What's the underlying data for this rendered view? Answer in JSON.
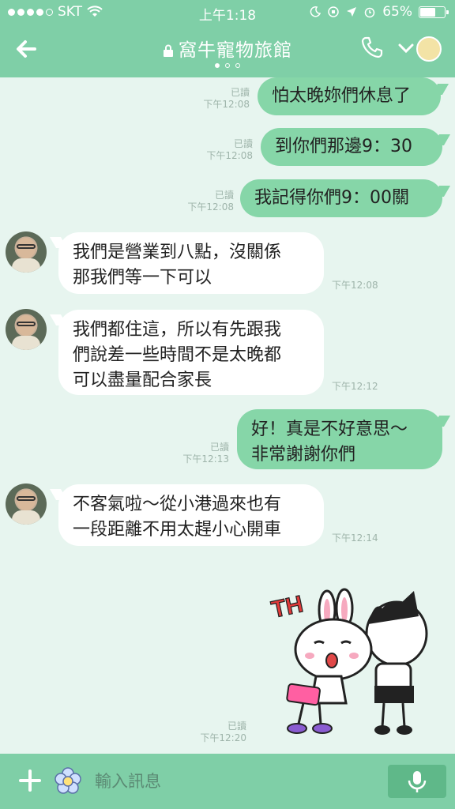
{
  "status_bar": {
    "carrier": "SKT",
    "time": "上午1:18",
    "battery": "65%",
    "battery_level": 0.65
  },
  "header": {
    "title": "窩牛寵物旅館",
    "back_icon": "arrow-left-icon",
    "call_icon": "phone-icon",
    "menu_icon": "chevron-down-icon"
  },
  "messages": [
    {
      "side": "out",
      "text": "怕太晚妳們休息了",
      "read": "已讀",
      "time": "下午12:08"
    },
    {
      "side": "out",
      "text": "到你們那邊9：30",
      "read": "已讀",
      "time": "下午12:08"
    },
    {
      "side": "out",
      "text": "我記得你們9：00關",
      "read": "已讀",
      "time": "下午12:08"
    },
    {
      "side": "in",
      "lines": [
        "我們是營業到八點，沒關係",
        "那我們等一下可以"
      ],
      "time": "下午12:08"
    },
    {
      "side": "in",
      "lines": [
        "我們都住這，所以有先跟我",
        "們說差一些時間不是太晚都",
        "可以盡量配合家長"
      ],
      "time": "下午12:12"
    },
    {
      "side": "out",
      "lines": [
        "好！真是不好意思～",
        "非常謝謝你們"
      ],
      "read": "已讀",
      "time": "下午12:13"
    },
    {
      "side": "in",
      "lines": [
        "不客氣啦～從小港過來也有",
        "一段距離不用太趕小心開車"
      ],
      "time": "下午12:14"
    },
    {
      "side": "out",
      "sticker": "bunny-and-cat-thanks",
      "sticker_text": "TH",
      "read": "已讀",
      "time": "下午12:20"
    }
  ],
  "input_bar": {
    "placeholder": "輸入訊息",
    "plus_icon": "plus-icon",
    "emoji_icon": "flower-emoji-icon",
    "mic_icon": "microphone-icon"
  },
  "colors": {
    "header": "#7fcfa7",
    "background": "#e7f5ef",
    "outgoing_bubble": "#86d6a8",
    "incoming_bubble": "#ffffff"
  }
}
